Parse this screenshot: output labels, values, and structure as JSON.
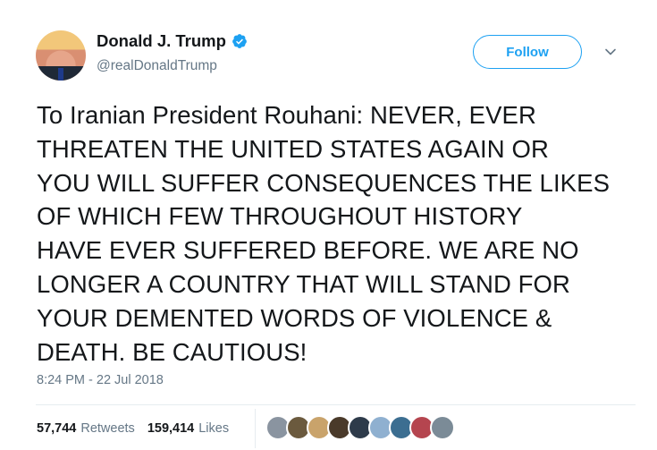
{
  "tweet": {
    "author": {
      "display_name": "Donald J. Trump",
      "handle": "@realDonaldTrump",
      "verified": true
    },
    "follow_label": "Follow",
    "text": "To Iranian President Rouhani: NEVER, EVER\nTHREATEN THE UNITED STATES AGAIN OR\nYOU WILL SUFFER CONSEQUENCES THE LIKES\nOF WHICH FEW THROUGHOUT HISTORY\nHAVE EVER SUFFERED BEFORE. WE ARE NO\nLONGER A COUNTRY THAT WILL STAND FOR\nYOUR DEMENTED WORDS OF VIOLENCE &\nDEATH. BE CAUTIOUS!",
    "timestamp": "8:24 PM - 22 Jul 2018",
    "retweets": {
      "count": "57,744",
      "label": "Retweets"
    },
    "likes": {
      "count": "159,414",
      "label": "Likes"
    }
  },
  "icons": {
    "verified": "verified-badge-icon",
    "caret": "chevron-down-icon"
  },
  "colors": {
    "accent": "#1da1f2",
    "text": "#14171a",
    "muted": "#657786",
    "divider": "#e6ecf0"
  },
  "liker_avatars": [
    "#8a94a0",
    "#6b5a3e",
    "#c9a36b",
    "#4a3a2a",
    "#2e3b4a",
    "#8fb0d0",
    "#3c6e91",
    "#b5454f",
    "#7b8b97"
  ]
}
